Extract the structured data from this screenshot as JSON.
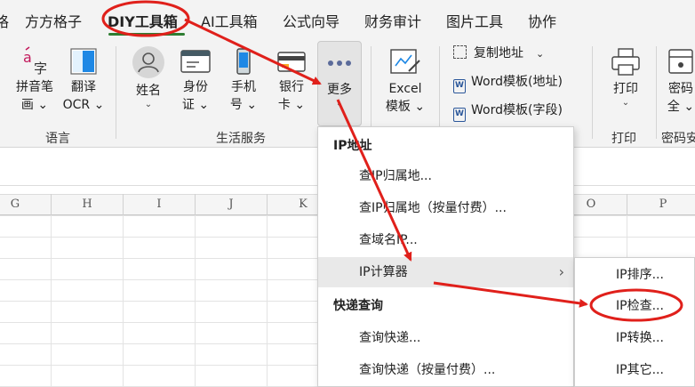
{
  "tabs": [
    "方方格子",
    "DIY工具箱",
    "AI工具箱",
    "公式向导",
    "财务审计",
    "图片工具",
    "协作"
  ],
  "ribbon": {
    "pinyin": {
      "line1": "拼音笔",
      "line2": "画"
    },
    "translate": {
      "line1": "翻译",
      "line2": "OCR"
    },
    "name": {
      "line1": "姓名"
    },
    "idcard": {
      "line1": "身份",
      "line2": "证"
    },
    "phone": {
      "line1": "手机",
      "line2": "号"
    },
    "bank": {
      "line1": "银行",
      "line2": "卡"
    },
    "more": {
      "line1": "更多"
    },
    "excel": {
      "line1": "Excel",
      "line2": "模板"
    },
    "copy_address": "复制地址",
    "word_address": "Word模板(地址)",
    "word_field": "Word模板(字段)",
    "print": {
      "line1": "打印"
    },
    "password": {
      "line1": "密码",
      "line2": "全"
    },
    "groups": {
      "language": "语言",
      "life": "生活服务",
      "print": "打印",
      "password": "密码安"
    }
  },
  "columns": [
    "G",
    "H",
    "I",
    "J",
    "K",
    "O",
    "P"
  ],
  "menu": {
    "section1": "IP地址",
    "ip_lookup": "查IP归属地...",
    "ip_lookup_paid": "查IP归属地（按量付费）...",
    "domain_lookup": "查域名IP...",
    "ip_calculator": "IP计算器",
    "section2": "快递查询",
    "express": "查询快递...",
    "express_paid": "查询快递（按量付费）..."
  },
  "submenu": {
    "sort": "IP排序...",
    "check": "IP检查...",
    "convert": "IP转换...",
    "other": "IP其它..."
  },
  "colors": {
    "annotation": "#e0201b",
    "active_tab_underline": "#2e7d32",
    "hover": "#e9e9e9"
  }
}
